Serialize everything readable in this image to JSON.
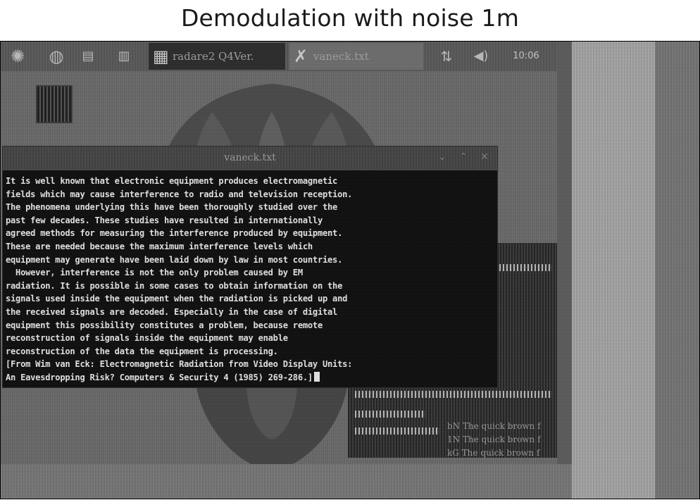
{
  "figure": {
    "title": "Demodulation with noise 1m"
  },
  "taskbar": {
    "tasks": [
      {
        "label": "radare2 Q4Ver.",
        "icon": "terminal-icon",
        "active": true
      },
      {
        "label": "vaneck.txt",
        "icon": "text-editor-icon",
        "active": false
      }
    ],
    "tray_text": "10:06"
  },
  "window": {
    "title": "vaneck.txt",
    "lines": [
      "It is well known that electronic equipment produces electromagnetic",
      "fields which may cause interference to radio and television reception.",
      "The phenomena underlying this have been thoroughly studied over the",
      "past few decades. These studies have resulted in internationally",
      "agreed methods for measuring the interference produced by equipment.",
      "These are needed because the maximum interference levels which",
      "equipment may generate have been laid down by law in most countries.",
      "  However, interference is not the only problem caused by EM",
      "radiation. It is possible in some cases to obtain information on the",
      "signals used inside the equipment when the radiation is picked up and",
      "the received signals are decoded. Especially in the case of digital",
      "equipment this possibility constitutes a problem, because remote",
      "reconstruction of signals inside the equipment may enable",
      "reconstruction of the data the equipment is processing.",
      "[From Wim van Eck: Electromagnetic Radiation from Video Display Units:",
      "An Eavesdropping Risk? Computers & Security 4 (1985) 269-286.]"
    ]
  },
  "background_terminal": {
    "lines": [
      "bN The quick brown f",
      "1N The quick brown f",
      "kG The quick brown f"
    ]
  }
}
